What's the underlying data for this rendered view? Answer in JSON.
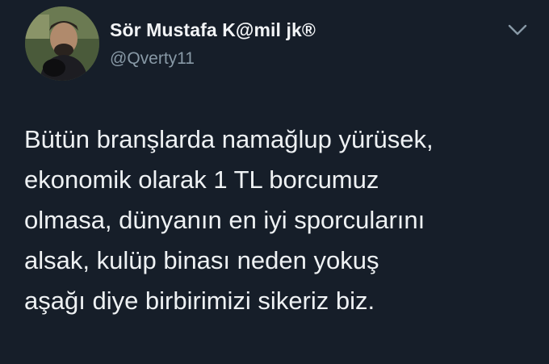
{
  "tweet": {
    "author": {
      "display_name": "Sör Mustafa K@mil jk®",
      "handle": "@Qverty11",
      "avatar_icon": "profile-photo"
    },
    "menu_icon": "chevron-down-icon",
    "text_lines": [
      "Bütün branşlarda namağlup yürüsek,",
      "ekonomik olarak 1 TL borcumuz",
      "olmasa, dünyanın en iyi sporcularını",
      "alsak, kulüp binası neden yokuş",
      "aşağı diye birbirimizi sikeriz biz."
    ]
  },
  "colors": {
    "background": "#161e29",
    "text": "#eef1f3",
    "handle": "#8899a6"
  }
}
